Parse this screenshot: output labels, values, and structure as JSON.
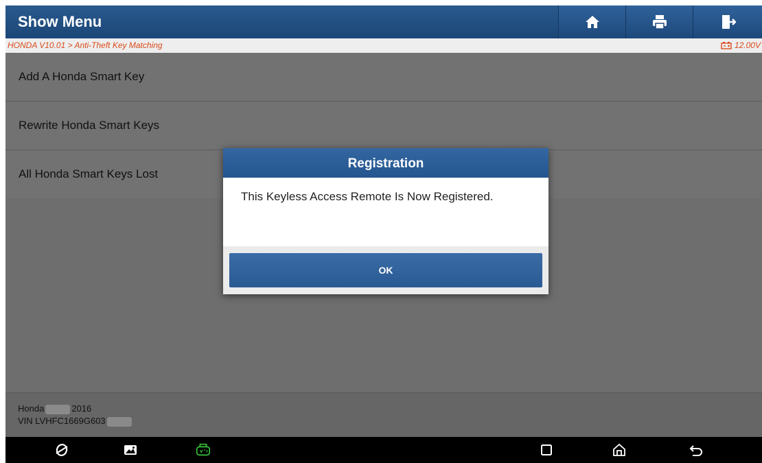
{
  "header": {
    "title": "Show Menu",
    "icons": [
      "home-icon",
      "print-icon",
      "exit-icon"
    ]
  },
  "breadcrumb": {
    "path": "HONDA V10.01 > Anti-Theft Key Matching",
    "voltage": "12.00V"
  },
  "menu": {
    "items": [
      {
        "label": "Add A Honda Smart Key"
      },
      {
        "label": "Rewrite Honda Smart Keys"
      },
      {
        "label": "All Honda Smart Keys Lost"
      }
    ]
  },
  "vehicle": {
    "make": "Honda",
    "year": "2016",
    "vin": "VIN LVHFC1669G603"
  },
  "dialog": {
    "title": "Registration",
    "message": "This Keyless Access Remote Is Now Registered.",
    "ok_label": "OK"
  },
  "navbar": {
    "icons": [
      "browser-icon",
      "gallery-icon",
      "vci-icon",
      "recents-icon",
      "home-nav-icon",
      "back-icon"
    ]
  },
  "colors": {
    "header_blue": "#1b4677",
    "breadcrumb_red": "#d94a1a",
    "vci_green": "#35c43a"
  }
}
